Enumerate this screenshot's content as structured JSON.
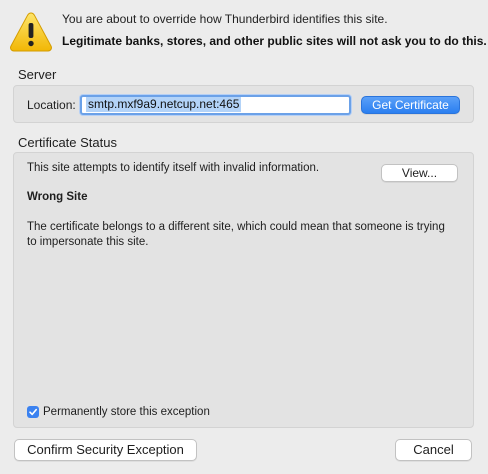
{
  "header": {
    "line1": "You are about to override how Thunderbird identifies this site.",
    "line2": "Legitimate banks, stores, and other public sites will not ask you to do this."
  },
  "server": {
    "group_label": "Server",
    "location_label": "Location:",
    "location_value": "smtp.mxf9a9.netcup.net:465",
    "get_certificate_label": "Get Certificate"
  },
  "certificate_status": {
    "group_label": "Certificate Status",
    "summary": "This site attempts to identify itself with invalid information.",
    "view_label": "View...",
    "problem_title": "Wrong Site",
    "problem_description": "The certificate belongs to a different site, which could mean that someone is trying to impersonate this site."
  },
  "permanent_store": {
    "label": "Permanently store this exception",
    "checked": true
  },
  "buttons": {
    "confirm_label": "Confirm Security Exception",
    "cancel_label": "Cancel"
  },
  "icons": {
    "warning": "warning-icon",
    "checkmark": "checkmark-icon"
  },
  "colors": {
    "accent": "#2a7ff0",
    "warning_yellow": "#f5c518",
    "selection": "#b3d3f8"
  }
}
